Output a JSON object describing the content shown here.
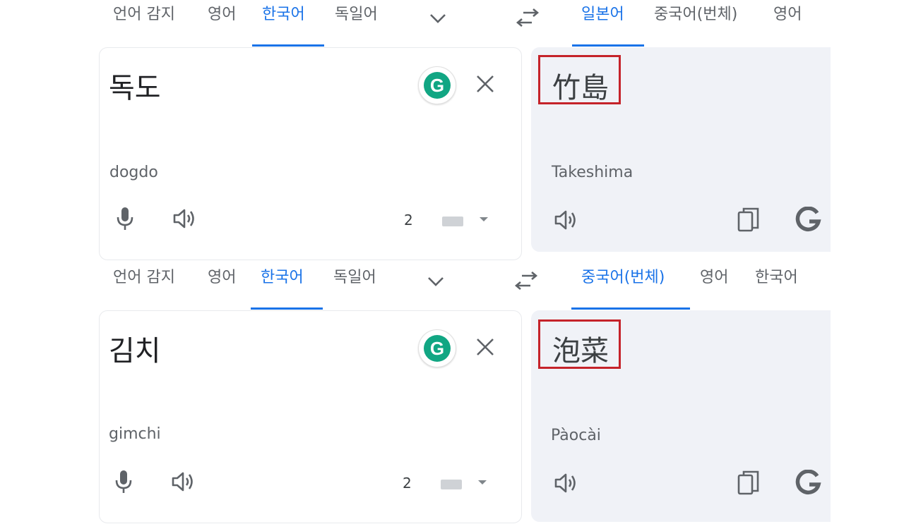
{
  "panels": [
    {
      "source_tabs": [
        "언어 감지",
        "영어",
        "한국어",
        "독일어"
      ],
      "target_tabs": [
        "일본어",
        "중국어(번체)",
        "영어"
      ],
      "source_text": "독도",
      "source_romanization": "dogdo",
      "translated_text": "竹島",
      "translated_romanization": "Takeshima",
      "char_count": "2"
    },
    {
      "source_tabs": [
        "언어 감지",
        "영어",
        "한국어",
        "독일어"
      ],
      "target_tabs": [
        "중국어(번체)",
        "영어",
        "한국어"
      ],
      "source_text": "김치",
      "source_romanization": "gimchi",
      "translated_text": "泡菜",
      "translated_romanization": "Pàocài",
      "char_count": "2"
    }
  ],
  "colors": {
    "accent": "#1a73e8",
    "highlight_box": "#c5232a",
    "target_bg": "#f0f2f7",
    "grammarly": "#11a683"
  },
  "icons": [
    "chevron-down-icon",
    "swap-languages-icon",
    "grammarly-icon",
    "close-icon",
    "microphone-icon",
    "speaker-icon",
    "keyboard-icon",
    "copy-icon",
    "google-icon"
  ]
}
